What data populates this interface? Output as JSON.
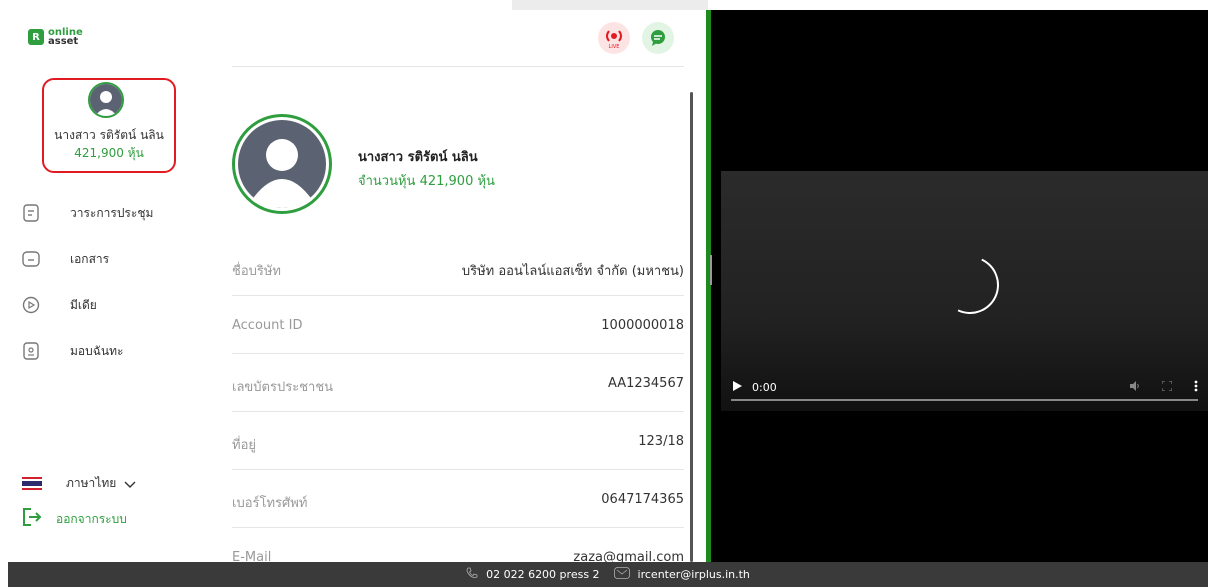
{
  "brand": {
    "line1": "online",
    "line2": "asset",
    "mark": "R"
  },
  "profile": {
    "name": "นางสาว รติรัตน์ นลิน",
    "shares": "421,900 หุ้น",
    "shares_full": "จำนวนหุ้น 421,900 หุ้น"
  },
  "nav": [
    {
      "label": "วาระการประชุม",
      "icon": "agenda-icon"
    },
    {
      "label": "เอกสาร",
      "icon": "folder-icon"
    },
    {
      "label": "มีเดีย",
      "icon": "play-circle-icon"
    },
    {
      "label": "มอบฉันทะ",
      "icon": "proxy-document-icon"
    }
  ],
  "language": {
    "label": "ภาษาไทย"
  },
  "logout": {
    "label": "ออกจากระบบ"
  },
  "header": {
    "live_badge": "LIVE"
  },
  "info": [
    {
      "label": "ชื่อบริษัท",
      "value": "บริษัท ออนไลน์แอสเซ็ท จำกัด (มหาชน)"
    },
    {
      "label": "Account ID",
      "value": "1000000018"
    },
    {
      "label": "เลขบัตรประชาชน",
      "value": "AA1234567"
    },
    {
      "label": "ที่อยู่",
      "value": "123/18"
    },
    {
      "label": "เบอร์โทรศัพท์",
      "value": "0647174365"
    },
    {
      "label": "E-Mail",
      "value": "zaza@gmail.com"
    }
  ],
  "video": {
    "time": "0:00"
  },
  "footer": {
    "phone": "02 022 6200 press 2",
    "email": "ircenter@irplus.in.th"
  },
  "colors": {
    "accent": "#2e9e3e",
    "highlight": "#e11b22",
    "footer": "#3a3a3a"
  }
}
